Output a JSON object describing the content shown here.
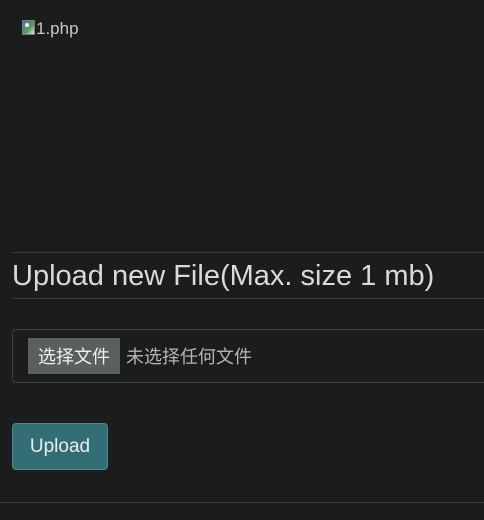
{
  "image": {
    "alt_text": "1.php",
    "icon": "broken-image-icon"
  },
  "upload_section": {
    "title": "Upload new File(Max. size 1 mb)",
    "file_input": {
      "button_label": "选择文件",
      "status_text": "未选择任何文件"
    },
    "submit_label": "Upload"
  },
  "colors": {
    "background": "#1b1c1c",
    "upload_button": "#336e74",
    "choose_button": "#5c5f60"
  }
}
